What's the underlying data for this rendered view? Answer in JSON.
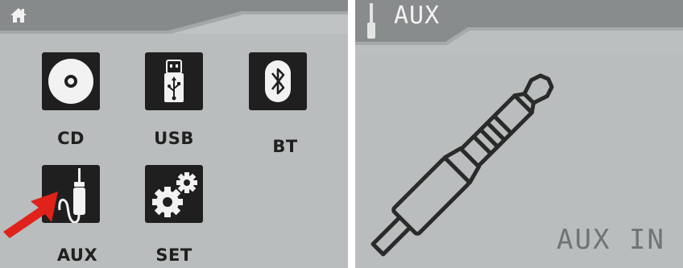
{
  "left_screen": {
    "header": {
      "home_icon": "home-icon"
    },
    "tiles": [
      {
        "label": "CD",
        "icon": "disc-icon"
      },
      {
        "label": "USB",
        "icon": "usb-icon"
      },
      {
        "label": "BT",
        "icon": "bluetooth-icon"
      },
      {
        "label": "AUX",
        "icon": "aux-cable-icon"
      },
      {
        "label": "SET",
        "icon": "gears-icon"
      }
    ],
    "pointer": {
      "icon": "red-arrow-icon",
      "color": "#e0221b"
    }
  },
  "right_screen": {
    "title": "AUX",
    "subtitle": "AUX IN",
    "icon": "aux-plug-icon"
  },
  "colors": {
    "background": "#b9bdbd",
    "tile": "#1f1f1f",
    "header": "#888c8c",
    "arrow": "#e0221b"
  }
}
